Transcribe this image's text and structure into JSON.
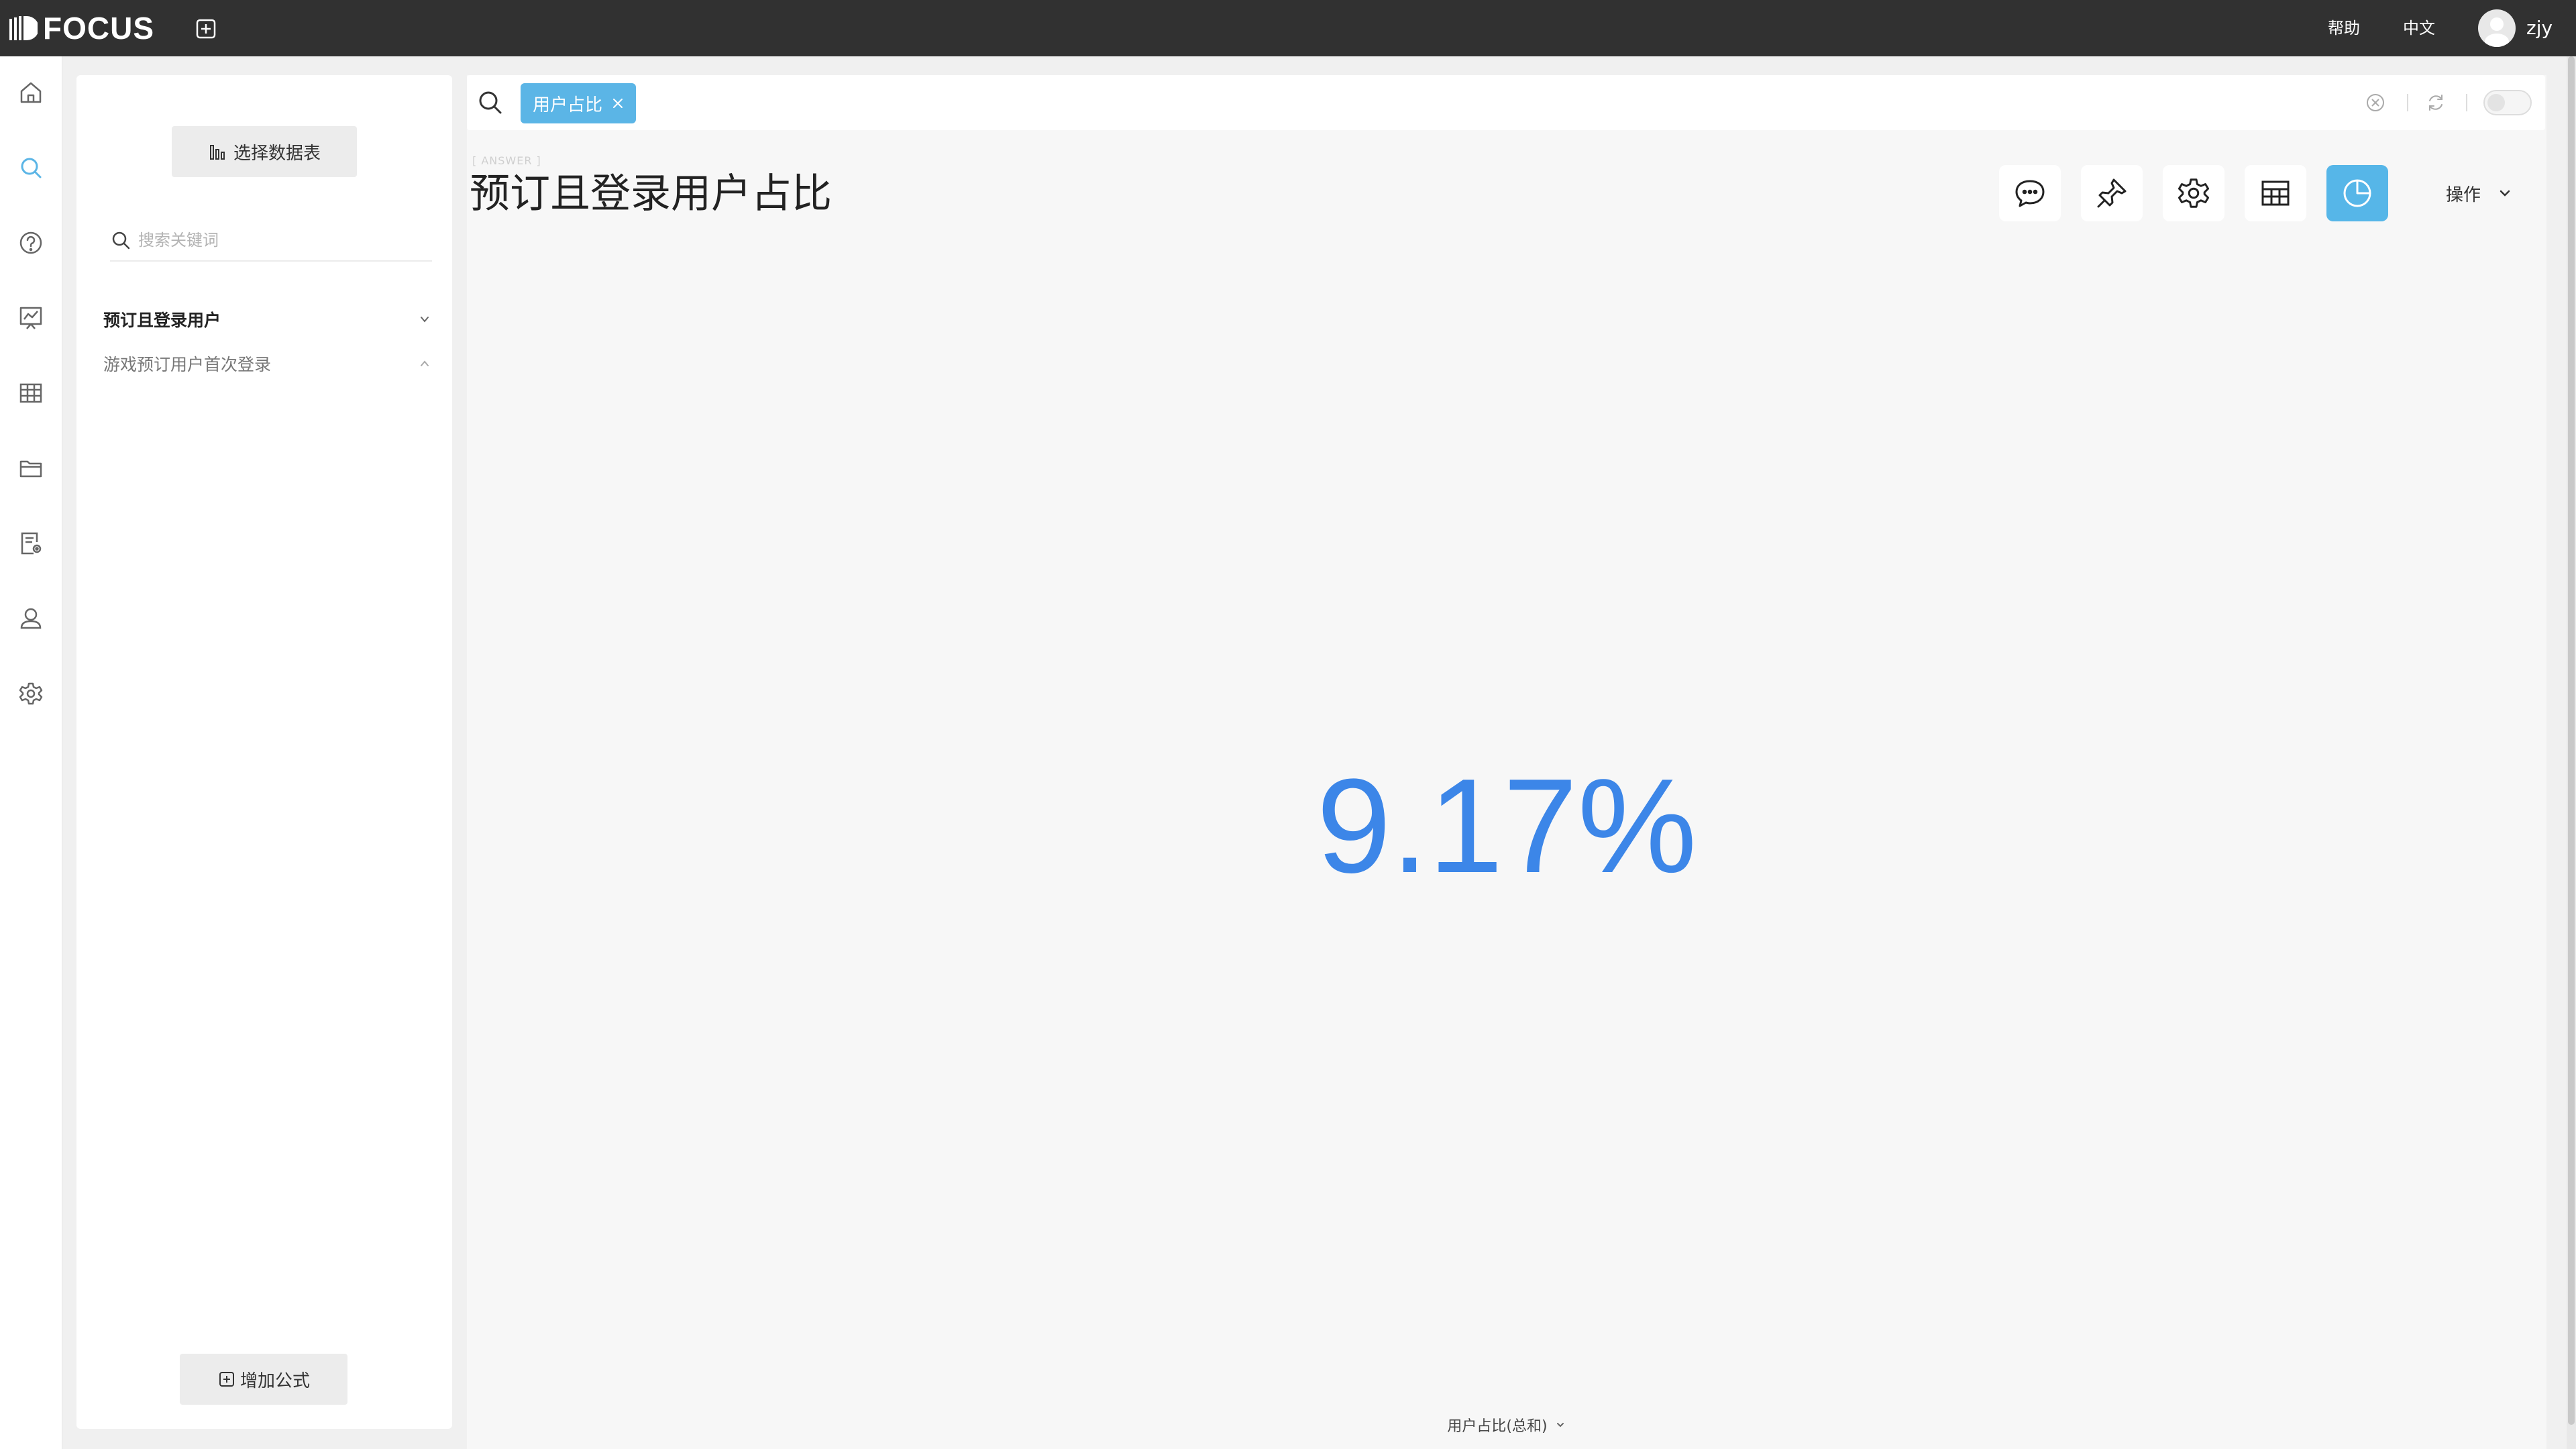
{
  "app": {
    "name": "FOCUS"
  },
  "topbar": {
    "help": "帮助",
    "language": "中文",
    "username": "zjy"
  },
  "nav": {
    "items": [
      "home-icon",
      "search-icon",
      "help-icon",
      "dashboard-icon",
      "table-icon",
      "folder-icon",
      "data-settings-icon",
      "user-icon",
      "settings-icon"
    ],
    "active": "search-icon",
    "active_color": "#5bb5e6"
  },
  "datasource": {
    "select_table_label": "选择数据表",
    "search_placeholder": "搜索关键词",
    "tables": [
      {
        "label": "预订且登录用户",
        "expanded": true
      },
      {
        "label": "游戏预订用户首次登录",
        "expanded": false
      }
    ],
    "add_formula_label": "增加公式"
  },
  "search": {
    "tokens": [
      {
        "label": "用户占比"
      }
    ]
  },
  "answer": {
    "tag": "[ ANSWER ]",
    "title": "预订且登录用户占比",
    "value": "9.17%",
    "measure_label": "用户占比(总和)",
    "operations_label": "操作",
    "value_color": "#3c86e8"
  },
  "toolbar": {
    "buttons": [
      "comment-icon",
      "pin-icon",
      "settings-icon",
      "table-view-icon",
      "chart-view-icon"
    ],
    "active": "chart-view-icon",
    "active_color": "#56b6e8"
  }
}
